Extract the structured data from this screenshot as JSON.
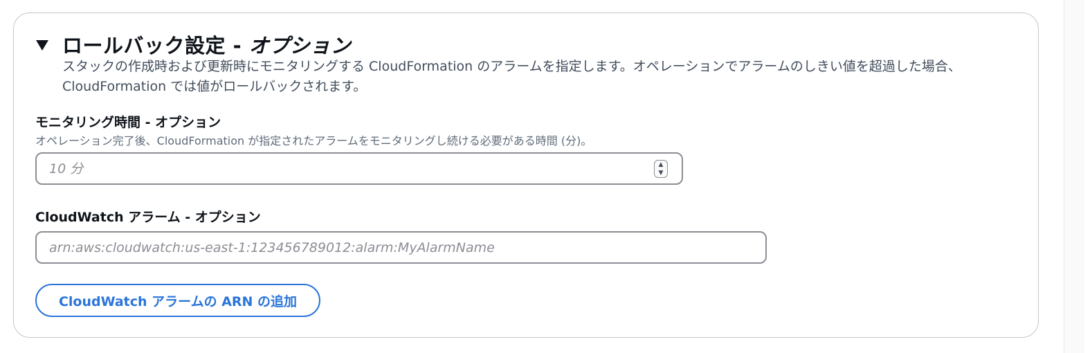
{
  "section": {
    "title": "ロールバック設定",
    "title_separator": " - ",
    "title_optional": "オプション",
    "description": "スタックの作成時および更新時にモニタリングする CloudFormation のアラームを指定します。オペレーションでアラームのしきい値を超過した場合、CloudFormation では値がロールバックされます。"
  },
  "monitoring_time": {
    "label": "モニタリング時間 - オプション",
    "hint": "オペレーション完了後、CloudFormation が指定されたアラームをモニタリングし続ける必要がある時間 (分)。",
    "placeholder": "10 分",
    "value": ""
  },
  "cloudwatch_alarm": {
    "label": "CloudWatch アラーム - オプション",
    "placeholder": "arn:aws:cloudwatch:us-east-1:123456789012:alarm:MyAlarmName",
    "value": ""
  },
  "add_button": {
    "label": "CloudWatch アラームの ARN の追加"
  },
  "icons": {
    "caret": "caret-down-icon",
    "stepper": "number-stepper-icon"
  },
  "colors": {
    "accent": "#2a75d8",
    "border": "#8c8c94",
    "text": "#0f141a",
    "secondary_text": "#414d5c"
  }
}
